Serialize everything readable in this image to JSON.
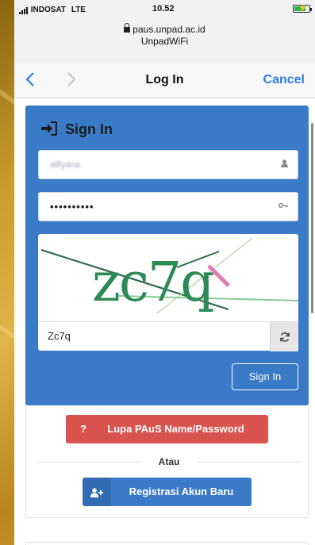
{
  "status_bar": {
    "carrier": "INDOSAT",
    "network": "LTE",
    "time": "10.52",
    "battery_percent": 75
  },
  "browser": {
    "url": "paus.unpad.ac.id",
    "site_name": "UnpadWiFi"
  },
  "nav": {
    "back_icon": "chevron-left-icon",
    "forward_icon": "chevron-right-icon",
    "title": "Log In",
    "cancel_label": "Cancel"
  },
  "login_panel": {
    "header": "Sign In",
    "username_value": "alfiyana",
    "password_value": "••••••••••",
    "captcha_text": "zc7q",
    "captcha_input_value": "Zc7q",
    "signin_button": "Sign In"
  },
  "actions": {
    "forgot_icon": "?",
    "forgot_label": "Lupa PAuS Name/Password",
    "divider_label": "Atau",
    "register_label": "Registrasi Akun Baru"
  },
  "colors": {
    "primary": "#3a7bc8",
    "danger": "#d9534f",
    "ios_blue": "#2a7fe0"
  }
}
